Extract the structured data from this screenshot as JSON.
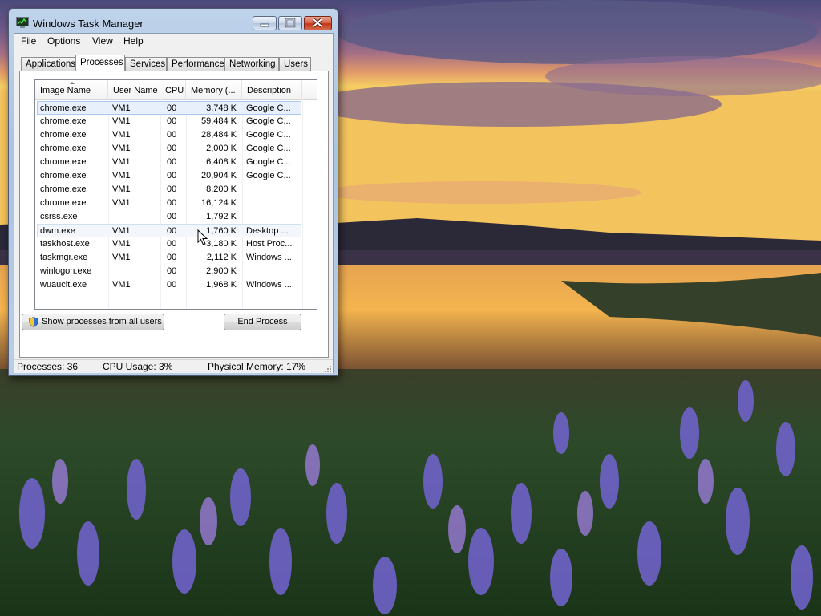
{
  "window": {
    "title": "Windows Task Manager"
  },
  "menu": [
    "File",
    "Options",
    "View",
    "Help"
  ],
  "tabs": [
    "Applications",
    "Processes",
    "Services",
    "Performance",
    "Networking",
    "Users"
  ],
  "active_tab": "Processes",
  "table": {
    "columns": [
      "Image Name",
      "User Name",
      "CPU",
      "Memory (...",
      "Description"
    ],
    "rows": [
      {
        "name": "chrome.exe",
        "user": "VM1",
        "cpu": "00",
        "mem": "3,748 K",
        "desc": "Google C..."
      },
      {
        "name": "chrome.exe",
        "user": "VM1",
        "cpu": "00",
        "mem": "59,484 K",
        "desc": "Google C..."
      },
      {
        "name": "chrome.exe",
        "user": "VM1",
        "cpu": "00",
        "mem": "28,484 K",
        "desc": "Google C..."
      },
      {
        "name": "chrome.exe",
        "user": "VM1",
        "cpu": "00",
        "mem": "2,000 K",
        "desc": "Google C..."
      },
      {
        "name": "chrome.exe",
        "user": "VM1",
        "cpu": "00",
        "mem": "6,408 K",
        "desc": "Google C..."
      },
      {
        "name": "chrome.exe",
        "user": "VM1",
        "cpu": "00",
        "mem": "20,904 K",
        "desc": "Google C..."
      },
      {
        "name": "chrome.exe",
        "user": "VM1",
        "cpu": "00",
        "mem": "8,200 K",
        "desc": ""
      },
      {
        "name": "chrome.exe",
        "user": "VM1",
        "cpu": "00",
        "mem": "16,124 K",
        "desc": ""
      },
      {
        "name": "csrss.exe",
        "user": "",
        "cpu": "00",
        "mem": "1,792 K",
        "desc": ""
      },
      {
        "name": "dwm.exe",
        "user": "VM1",
        "cpu": "00",
        "mem": "1,760 K",
        "desc": "Desktop ..."
      },
      {
        "name": "taskhost.exe",
        "user": "VM1",
        "cpu": "00",
        "mem": "3,180 K",
        "desc": "Host Proc..."
      },
      {
        "name": "taskmgr.exe",
        "user": "VM1",
        "cpu": "00",
        "mem": "2,112 K",
        "desc": "Windows ..."
      },
      {
        "name": "winlogon.exe",
        "user": "",
        "cpu": "00",
        "mem": "2,900 K",
        "desc": ""
      },
      {
        "name": "wuauclt.exe",
        "user": "VM1",
        "cpu": "00",
        "mem": "1,968 K",
        "desc": "Windows ..."
      }
    ]
  },
  "buttons": {
    "show_all": "Show processes from all users",
    "end_process": "End Process"
  },
  "status": {
    "processes": "Processes: 36",
    "cpu": "CPU Usage: 3%",
    "memory": "Physical Memory: 17%"
  },
  "colors": {
    "selection": "#e8f1fb",
    "close_button": "#c23818",
    "titlebar": "#bfd3ea"
  }
}
